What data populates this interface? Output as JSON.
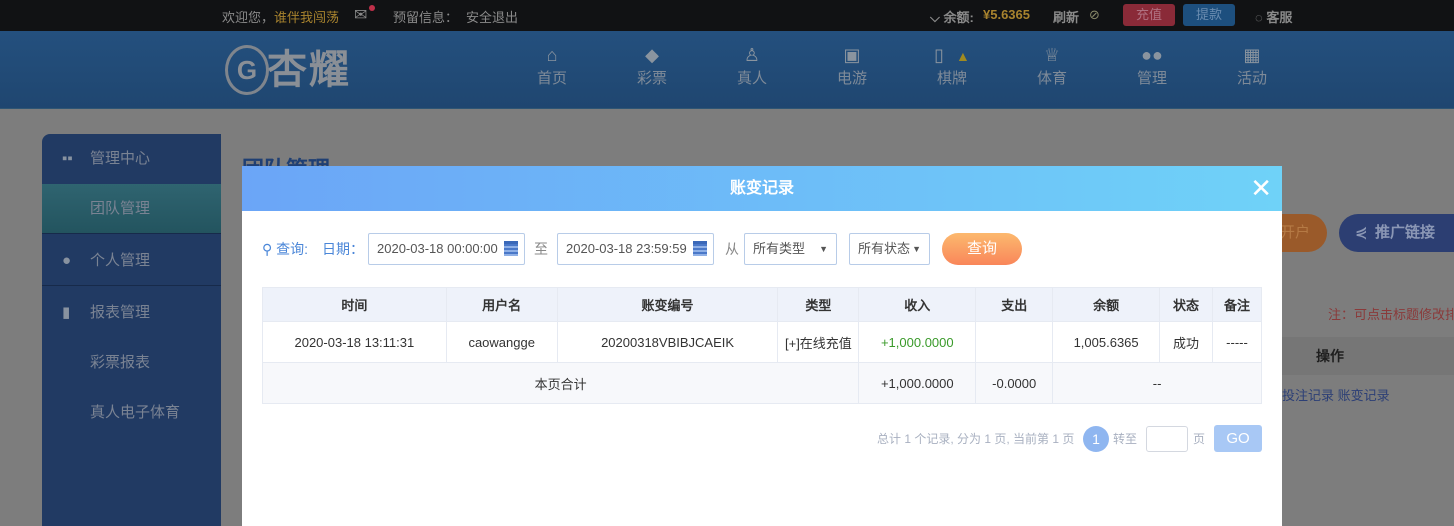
{
  "topbar": {
    "welcome": "欢迎您，",
    "username": "谁伴我闯荡",
    "reserved_info": "预留信息：",
    "logout": "安全退出",
    "balance_label": "余额:",
    "balance": "¥5.6365",
    "refresh": "刷新",
    "deposit": "充值",
    "withdraw": "提款",
    "support": "客服"
  },
  "logo": {
    "text": "杏耀"
  },
  "nav": [
    {
      "label": "首页",
      "icon": "home-icon"
    },
    {
      "label": "彩票",
      "icon": "lottery-icon"
    },
    {
      "label": "真人",
      "icon": "live-icon"
    },
    {
      "label": "电游",
      "icon": "slot-icon"
    },
    {
      "label": "棋牌",
      "icon": "mahjong-icon"
    },
    {
      "label": "体育",
      "icon": "trophy-icon"
    },
    {
      "label": "管理",
      "icon": "users-icon"
    },
    {
      "label": "活动",
      "icon": "gift-icon"
    }
  ],
  "sidebar": {
    "items": [
      {
        "label": "管理中心"
      },
      {
        "label": "团队管理"
      },
      {
        "label": "个人管理"
      },
      {
        "label": "报表管理"
      },
      {
        "label": "彩票报表"
      },
      {
        "label": "真人电子体育"
      }
    ]
  },
  "background": {
    "title": "团队管理",
    "open_account": "开户",
    "promo_link": "推广链接",
    "note": "注：可点击标题修改排序",
    "op_header": "操作",
    "op_links": "投注记录  账变记录"
  },
  "modal": {
    "title": "账变记录",
    "query_label": "查询:",
    "date_label": "日期：",
    "date_from": "2020-03-18 00:00:00",
    "to": "至",
    "date_to": "2020-03-18 23:59:59",
    "from": "从",
    "type_select": "所有类型",
    "status_select": "所有状态",
    "query_button": "查询",
    "columns": [
      "时间",
      "用户名",
      "账变编号",
      "类型",
      "收入",
      "支出",
      "余额",
      "状态",
      "备注"
    ],
    "rows": [
      [
        "2020-03-18 13:11:31",
        "caowangge",
        "20200318VBIBJCAEIK",
        "[+]在线充值",
        "+1,000.0000",
        "",
        "1,005.6365",
        "成功",
        "-----"
      ]
    ],
    "summary": {
      "label": "本页合计",
      "income": "+1,000.0000",
      "expense": "-0.0000",
      "balance": "--"
    },
    "pager": {
      "info": "总计 1 个记录, 分为 1 页, 当前第 1 页",
      "current": "1",
      "goto": "转至",
      "page_unit": "页",
      "go": "GO"
    }
  }
}
